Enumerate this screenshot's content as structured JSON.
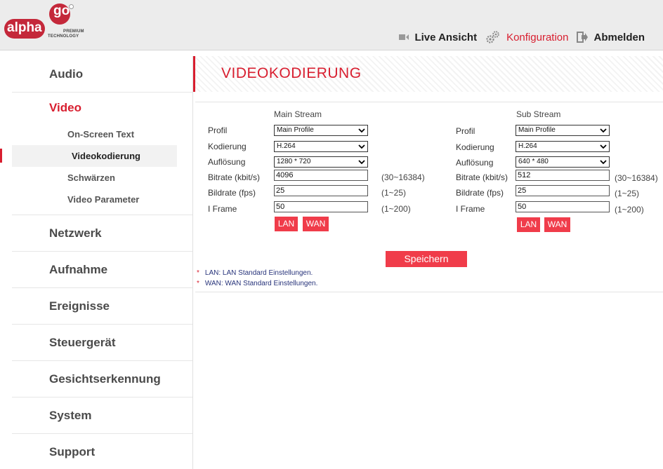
{
  "header": {
    "logo": {
      "alpha": "alpha",
      "go": "go",
      "tagline1": "PREMIUM",
      "tagline2": "TECHNOLOGY"
    },
    "nav": [
      {
        "label": "Live Ansicht",
        "icon": "video-camera-icon"
      },
      {
        "label": "Konfiguration",
        "icon": "gears-icon",
        "active": true
      },
      {
        "label": "Abmelden",
        "icon": "logout-icon"
      }
    ]
  },
  "sidebar": {
    "items": [
      {
        "label": "Audio"
      },
      {
        "label": "Video",
        "active": true,
        "children": [
          {
            "label": "On-Screen Text"
          },
          {
            "label": "Videokodierung",
            "active": true
          },
          {
            "label": "Schwärzen"
          },
          {
            "label": "Video Parameter"
          }
        ]
      },
      {
        "label": "Netzwerk"
      },
      {
        "label": "Aufnahme"
      },
      {
        "label": "Ereignisse"
      },
      {
        "label": "Steuergerät"
      },
      {
        "label": "Gesichtserkennung"
      },
      {
        "label": "System"
      },
      {
        "label": "Support"
      }
    ]
  },
  "page": {
    "title": "VIDEOKODIERUNG"
  },
  "main_stream": {
    "heading": "Main Stream",
    "labels": {
      "profile": "Profil",
      "encoding": "Kodierung",
      "resolution": "Auflösung",
      "bitrate": "Bitrate (kbit/s)",
      "framerate": "Bildrate (fps)",
      "iframe": "I Frame"
    },
    "profile": "Main Profile",
    "encoding": "H.264",
    "resolution": "1280 * 720",
    "bitrate": "4096",
    "framerate": "25",
    "iframe": "50",
    "bitrate_range": "(30~16384)",
    "framerate_range": "(1~25)",
    "iframe_range": "(1~200)",
    "lan_button": "LAN",
    "wan_button": "WAN"
  },
  "sub_stream": {
    "heading": "Sub Stream",
    "labels": {
      "profile": "Profil",
      "encoding": "Kodierung",
      "resolution": "Auflösung",
      "bitrate": "Bitrate (kbit/s)",
      "framerate": "Bildrate (fps)",
      "iframe": "I Frame"
    },
    "profile": "Main Profile",
    "encoding": "H.264",
    "resolution": "640 * 480",
    "bitrate": "512",
    "framerate": "25",
    "iframe": "50",
    "bitrate_range": "(30~16384)",
    "framerate_range": "(1~25)",
    "iframe_range": "(1~200)",
    "lan_button": "LAN",
    "wan_button": "WAN"
  },
  "save_button": "Speichern",
  "notes": [
    "LAN: LAN Standard Einstellungen.",
    "WAN: WAN Standard Einstellungen."
  ],
  "colors": {
    "accent": "#d81e2f",
    "button": "#f03c4a",
    "note_text": "#27337a"
  }
}
